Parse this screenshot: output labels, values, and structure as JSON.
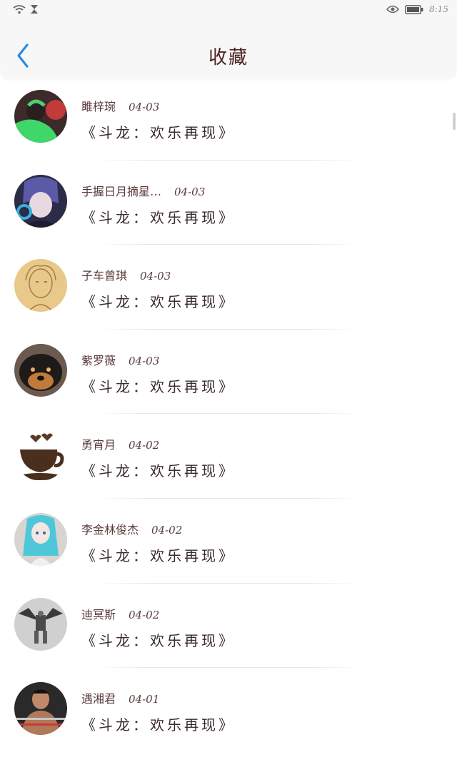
{
  "status_bar": {
    "time": "8:15",
    "icons": [
      "wifi-icon",
      "hourglass-icon",
      "eye-icon",
      "battery-icon"
    ]
  },
  "header": {
    "title": "收藏",
    "back_icon": "chevron-left-icon",
    "accent": "#2a8be0"
  },
  "items": [
    {
      "name": "雎梓琬",
      "date": "04-03",
      "work": "《斗龙：欢乐再现》",
      "avatar": "avatar-green-figure"
    },
    {
      "name": "手握日月摘星…",
      "date": "04-03",
      "work": "《斗龙：欢乐再现》",
      "avatar": "avatar-anime-headphones"
    },
    {
      "name": "子车曾琪",
      "date": "04-03",
      "work": "《斗龙：欢乐再现》",
      "avatar": "avatar-sketch-girl"
    },
    {
      "name": "紫罗薇",
      "date": "04-03",
      "work": "《斗龙：欢乐再现》",
      "avatar": "avatar-dog"
    },
    {
      "name": "勇宵月",
      "date": "04-02",
      "work": "《斗龙：欢乐再现》",
      "avatar": "avatar-coffee-cup"
    },
    {
      "name": "李金林俊杰",
      "date": "04-02",
      "work": "《斗龙：欢乐再现》",
      "avatar": "avatar-anime-teal-hair"
    },
    {
      "name": "迪冥斯",
      "date": "04-02",
      "work": "《斗龙：欢乐再现》",
      "avatar": "avatar-robot"
    },
    {
      "name": "遇湘君",
      "date": "04-01",
      "work": "《斗龙：欢乐再现》",
      "avatar": "avatar-boxer"
    }
  ]
}
